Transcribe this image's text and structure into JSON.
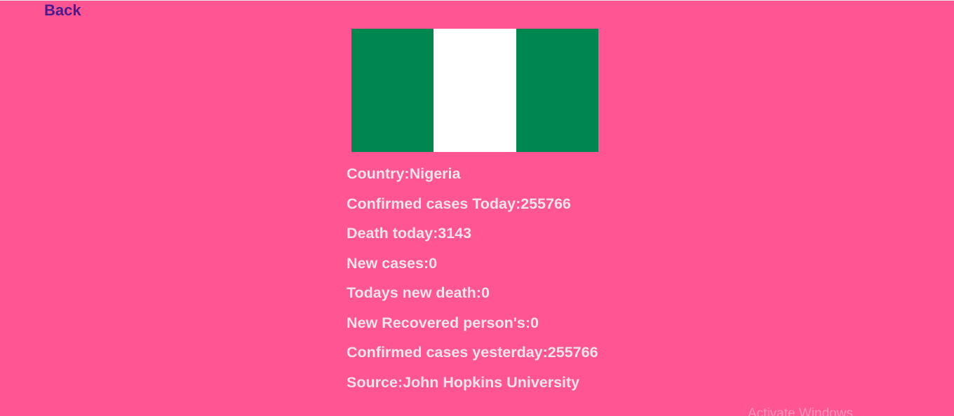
{
  "nav": {
    "back_label": "Back"
  },
  "flag": {
    "country": "Nigeria",
    "colors": [
      "#00874f",
      "#ffffff",
      "#00874f"
    ]
  },
  "stats": [
    {
      "label": "Country:",
      "value": "Nigeria"
    },
    {
      "label": "Confirmed cases Today:",
      "value": "255766"
    },
    {
      "label": "Death today:",
      "value": "3143"
    },
    {
      "label": "New cases:",
      "value": "0"
    },
    {
      "label": "Todays new death:",
      "value": "0"
    },
    {
      "label": "New Recovered person's:",
      "value": "0"
    },
    {
      "label": "Confirmed cases yesterday:",
      "value": "255766"
    },
    {
      "label": "Source:",
      "value": "John Hopkins University"
    }
  ],
  "watermark": "Activate Windows",
  "theme": {
    "background": "#ff5593",
    "back_link_color": "#4b1a8c",
    "text_color": "#f3e3ea"
  }
}
